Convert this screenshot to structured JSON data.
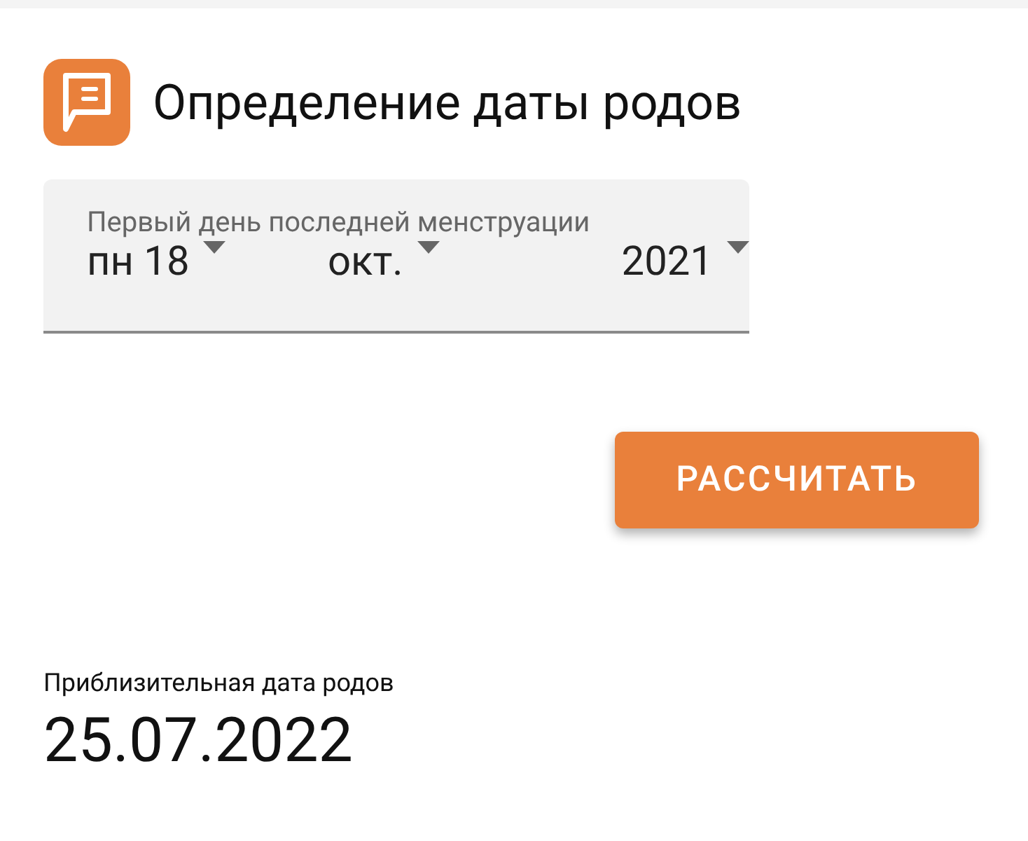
{
  "header": {
    "title": "Определение даты родов"
  },
  "date_field": {
    "label": "Первый день последней менструации",
    "selects": [
      {
        "value": "пн 18"
      },
      {
        "value": "окт."
      },
      {
        "value": "2021"
      }
    ]
  },
  "button": {
    "label": "РАССЧИТАТЬ"
  },
  "result": {
    "label": "Приблизительная дата родов",
    "value": "25.07.2022"
  }
}
